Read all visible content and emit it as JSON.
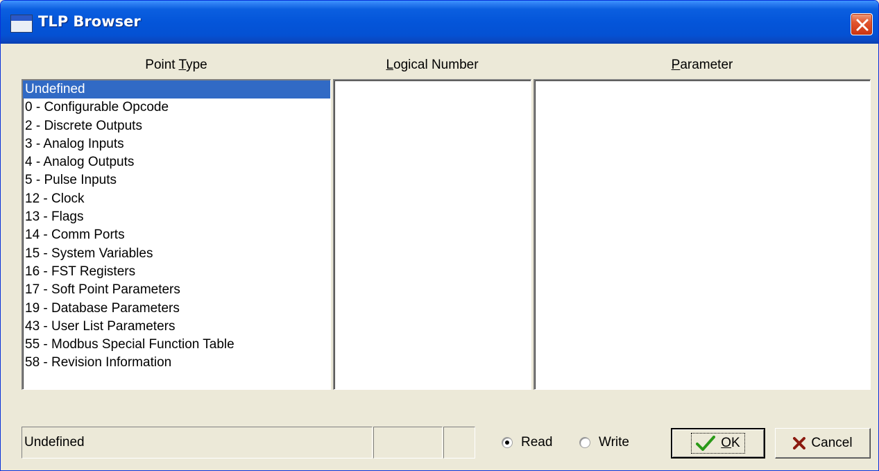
{
  "window": {
    "title": "TLP Browser"
  },
  "headers": {
    "point_type": {
      "before": "Point ",
      "underline": "T",
      "after": "ype"
    },
    "logical_number": {
      "before": "",
      "underline": "L",
      "after": "ogical Number"
    },
    "parameter": {
      "before": "",
      "underline": "P",
      "after": "arameter"
    }
  },
  "point_types": [
    "Undefined",
    "0 - Configurable Opcode",
    "2 - Discrete Outputs",
    "3 - Analog Inputs",
    "4 - Analog Outputs",
    "5 - Pulse Inputs",
    "12 - Clock",
    "13 - Flags",
    "14 - Comm Ports",
    "15 - System Variables",
    "16 - FST Registers",
    "17 - Soft Point Parameters",
    "19 - Database Parameters",
    "43 - User List Parameters",
    "55 - Modbus Special Function Table",
    "58 - Revision Information"
  ],
  "selected_index": 0,
  "status": {
    "main": "Undefined",
    "field2": "",
    "field3": ""
  },
  "mode": {
    "read_label": "Read",
    "write_label": "Write",
    "selected": "read"
  },
  "buttons": {
    "ok": {
      "before": "",
      "underline": "O",
      "after": "K",
      "icon": "checkmark-icon"
    },
    "cancel": {
      "label": "Cancel",
      "icon": "x-icon"
    }
  },
  "colors": {
    "selection": "#316ac5",
    "titlebar": "#0455d9",
    "face": "#ece9d8",
    "ok_check": "#2a9a18",
    "cancel_x": "#8b1a10"
  }
}
